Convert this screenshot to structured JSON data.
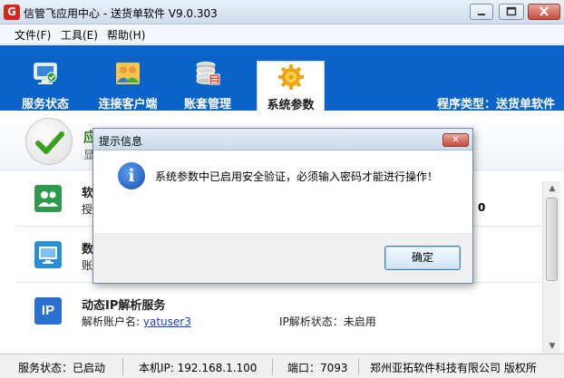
{
  "window": {
    "title": "信管飞应用中心 - 送货单软件 V9.0.303",
    "logo": "G"
  },
  "menu": [
    {
      "label": "文件(F)"
    },
    {
      "label": "工具(E)"
    },
    {
      "label": "帮助(H)"
    }
  ],
  "toolbar": {
    "items": [
      {
        "label": "服务状态",
        "icon": "monitor-check-icon"
      },
      {
        "label": "连接客户端",
        "icon": "users-icon"
      },
      {
        "label": "账套管理",
        "icon": "database-icon"
      },
      {
        "label": "系统参数",
        "icon": "gear-icon"
      }
    ],
    "program_type": "程序类型：送货单软件",
    "colors": {
      "bar": "#0a63c8",
      "active": "#ffffff"
    }
  },
  "header": {
    "title": "应",
    "sub": "显"
  },
  "rows": [
    {
      "title": "软",
      "sub": "授",
      "icon": "users-icon"
    },
    {
      "title": "数",
      "sub": "账",
      "icon": "monitor-icon"
    },
    {
      "title": "动态IP解析服务",
      "sub_label": "解析账户名:",
      "account": "yatuser3",
      "status_label": "IP解析状态：",
      "status_value": "未启用",
      "icon": "ip-icon",
      "icon_text": "IP"
    }
  ],
  "stray_value": "0",
  "statusbar": {
    "service": "服务状态：已启动",
    "ip": "本机IP: 192.168.1.100",
    "port": "端口：7093",
    "copyright": "郑州亚拓软件科技有限公司 版权所"
  },
  "dialog": {
    "title": "提示信息",
    "message": "系统参数中已启用安全验证，必须输入密码才能进行操作！",
    "ok_label": "确定",
    "close_glyph": "✕",
    "info_glyph": "i"
  }
}
